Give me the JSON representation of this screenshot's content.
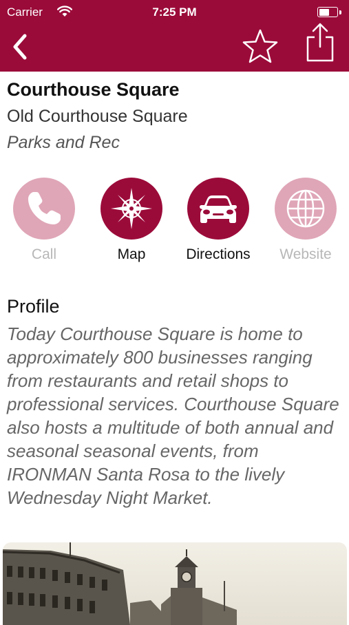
{
  "status_bar": {
    "carrier": "Carrier",
    "time": "7:25 PM"
  },
  "nav": {
    "back_icon": "chevron-left-icon",
    "favorite_icon": "star-outline-icon",
    "share_icon": "share-icon",
    "color": "#9b0b3a"
  },
  "place": {
    "title": "Courthouse Square",
    "address": "Old Courthouse Square",
    "category": "Parks and Rec"
  },
  "actions": [
    {
      "label": "Call",
      "icon": "phone-icon",
      "enabled": false
    },
    {
      "label": "Map",
      "icon": "compass-icon",
      "enabled": true
    },
    {
      "label": "Directions",
      "icon": "car-icon",
      "enabled": true
    },
    {
      "label": "Website",
      "icon": "globe-icon",
      "enabled": false
    }
  ],
  "profile": {
    "heading": "Profile",
    "text": "Today Courthouse Square is home to approximately 800 businesses ranging from restaurants and retail shops to professional services. Courthouse Square also hosts a multitude of both annual and seasonal seasonal events, from IRONMAN Santa Rosa to the lively Wednesday Night Market."
  },
  "colors": {
    "brand": "#9b0b3a",
    "brand_light": "#dfa6b7",
    "disabled_text": "#b7b7b7"
  }
}
